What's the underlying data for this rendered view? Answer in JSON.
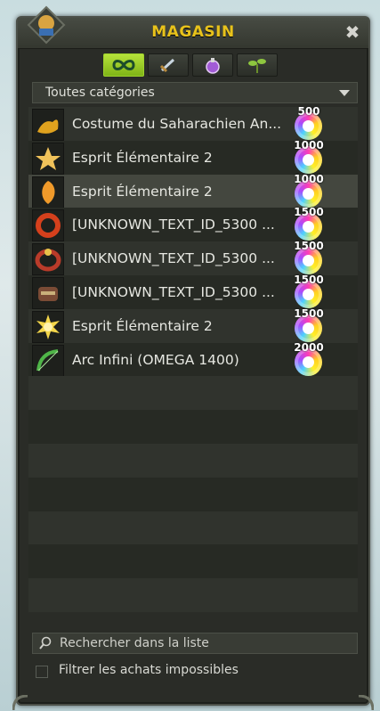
{
  "window": {
    "title": "MAGASIN",
    "close_glyph": "✖"
  },
  "tabs": [
    {
      "icon": "infinity-icon",
      "active": true
    },
    {
      "icon": "sword-icon",
      "active": false
    },
    {
      "icon": "potion-icon",
      "active": false
    },
    {
      "icon": "plant-icon",
      "active": false
    }
  ],
  "category": {
    "selected": "Toutes catégories"
  },
  "items": [
    {
      "name": "Costume du Saharachien An...",
      "price": "500",
      "icon": "costume-icon"
    },
    {
      "name": "Esprit Élémentaire 2",
      "price": "1000",
      "icon": "spirit-icon"
    },
    {
      "name": "Esprit Élémentaire 2",
      "price": "1000",
      "icon": "spirit-icon"
    },
    {
      "name": "[UNKNOWN_TEXT_ID_5300 ...",
      "price": "1500",
      "icon": "ring-icon"
    },
    {
      "name": "[UNKNOWN_TEXT_ID_5300 ...",
      "price": "1500",
      "icon": "belt-icon"
    },
    {
      "name": "[UNKNOWN_TEXT_ID_5300 ...",
      "price": "1500",
      "icon": "helmet-icon"
    },
    {
      "name": "Esprit Élémentaire 2",
      "price": "1500",
      "icon": "sun-icon"
    },
    {
      "name": "Arc Infini (OMEGA 1400)",
      "price": "2000",
      "icon": "bow-icon"
    }
  ],
  "search": {
    "placeholder": "Rechercher dans la liste",
    "value": ""
  },
  "filter": {
    "label": "Filtrer les achats impossibles",
    "checked": false
  },
  "colors": {
    "title": "#e8c21b",
    "active_tab": "#9ed22c",
    "panel": "#2a2c27"
  }
}
